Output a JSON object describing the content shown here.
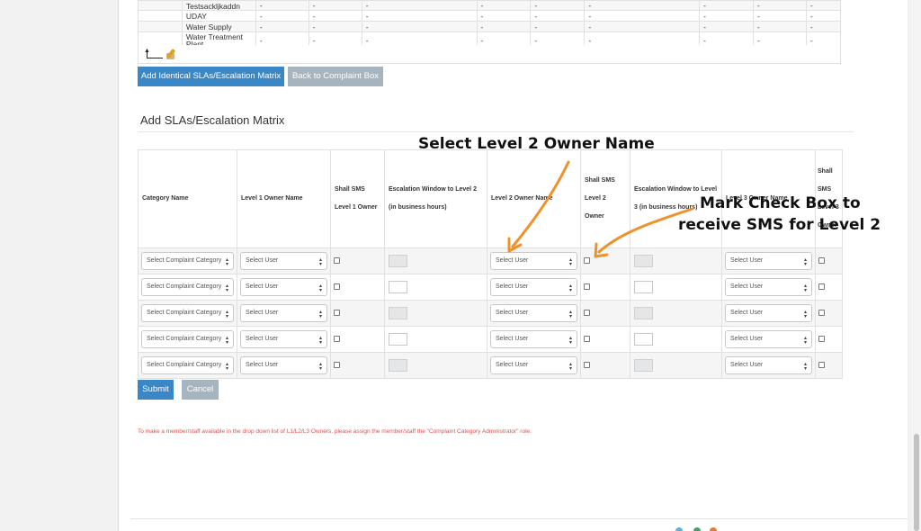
{
  "top_table": {
    "rows": [
      {
        "name": "Testsackljkaddn",
        "cells": [
          "-",
          "-",
          "-",
          "-",
          "-",
          "-",
          "-",
          "-",
          "-"
        ]
      },
      {
        "name": "UDAY",
        "cells": [
          "-",
          "-",
          "-",
          "-",
          "-",
          "-",
          "-",
          "-",
          "-"
        ]
      },
      {
        "name": "Water Supply",
        "cells": [
          "-",
          "-",
          "-",
          "-",
          "-",
          "-",
          "-",
          "-",
          "-"
        ]
      },
      {
        "name": "Water Treatment Plant",
        "cells": [
          "-",
          "-",
          "-",
          "-",
          "-",
          "-",
          "-",
          "-",
          "-"
        ]
      }
    ]
  },
  "buttons": {
    "add_identical": "Add Identical SLAs/Escalation Matrix",
    "back": "Back to Complaint Box",
    "submit": "Submit",
    "cancel": "Cancel"
  },
  "section_title": "Add SLAs/Escalation Matrix",
  "sla_table": {
    "headers": {
      "category": "Category Name",
      "l1_owner": "Level 1 Owner Name",
      "sms_l1": "Shall SMS Level 1 Owner",
      "esc_l2": "Escalation Window to Level 2 (in business hours)",
      "l2_owner": "Level 2 Owner Name",
      "sms_l2": "Shall SMS Level 2 Owner",
      "esc_l3": "Escalation Window to Level 3 (in business hours)",
      "l3_owner": "Level 3 Owner Name",
      "sms_l3": "Shall SMS Level 3 Owner"
    },
    "category_placeholder": "Select Complaint Category",
    "user_placeholder": "Select User",
    "rows": [
      {
        "esc_disabled": true
      },
      {
        "esc_disabled": false
      },
      {
        "esc_disabled": true
      },
      {
        "esc_disabled": false
      },
      {
        "esc_disabled": true
      }
    ]
  },
  "note": "To make a member/staff available in the drop down list of L1/L2/L3 Owners, please assign the member/staff the \"Complaint Category Administrator\" role.",
  "annotations": {
    "level2_name": "Select Level 2 Owner Name",
    "checkbox_line1": "Mark Check Box to",
    "checkbox_line2": "receive SMS for Level 2",
    "arrow_color": "#f0922b"
  },
  "colors": {
    "primary": "#3a87c8",
    "secondary": "#a6b4c0",
    "note": "#d9534f"
  },
  "icons": [
    "return-arrow-icon",
    "edit-icon",
    "chevron-updown-icon"
  ]
}
